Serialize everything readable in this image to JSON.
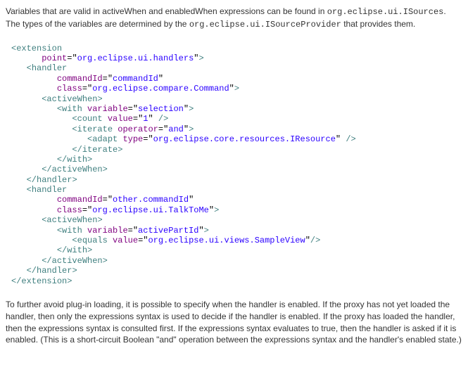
{
  "intro": {
    "line1_pre": "Variables that are valid in activeWhen and enabledWhen expressions can be found in ",
    "isources": "org.eclipse.ui.ISources",
    "line1_mid": ". The types of the variables are determined by the ",
    "isourceprovider": "org.eclipse.ui.ISourceProvider",
    "line1_post": " that provides them."
  },
  "code": {
    "l01": "<extension",
    "l02_a": "point",
    "l02_v": "org.eclipse.ui.handlers",
    "l03": "<handler",
    "l04_a": "commandId",
    "l04_v": "commandId",
    "l05_a": "class",
    "l05_v": "org.eclipse.compare.Command",
    "l06": "<activeWhen>",
    "l07_a": "variable",
    "l07_v": "selection",
    "l08_a": "value",
    "l08_v": "1",
    "l09_a": "operator",
    "l09_v": "and",
    "l10_a": "type",
    "l10_v": "org.eclipse.core.resources.IResource",
    "l11": "</iterate>",
    "l12": "</with>",
    "l13": "</activeWhen>",
    "l14": "</handler>",
    "l15": "<handler",
    "l16_a": "commandId",
    "l16_v": "other.commandId",
    "l17_a": "class",
    "l17_v": "org.eclipse.ui.TalkToMe",
    "l18": "<activeWhen>",
    "l19_a": "variable",
    "l19_v": "activePartId",
    "l20_a": "value",
    "l20_v": "org.eclipse.ui.views.SampleView",
    "l21": "</with>",
    "l22": "</activeWhen>",
    "l23": "</handler>",
    "l24": "</extension>"
  },
  "outro": {
    "text": "To further avoid plug-in loading, it is possible to specify when the handler is enabled. If the proxy has not yet loaded the handler, then only the expressions syntax is used to decide if the handler is enabled. If the proxy has loaded the handler, then the expressions syntax is consulted first. If the expressions syntax evaluates to true, then the handler is asked if it is enabled. (This is a short-circuit Boolean \"and\" operation between the expressions syntax and the handler's enabled state.)"
  }
}
